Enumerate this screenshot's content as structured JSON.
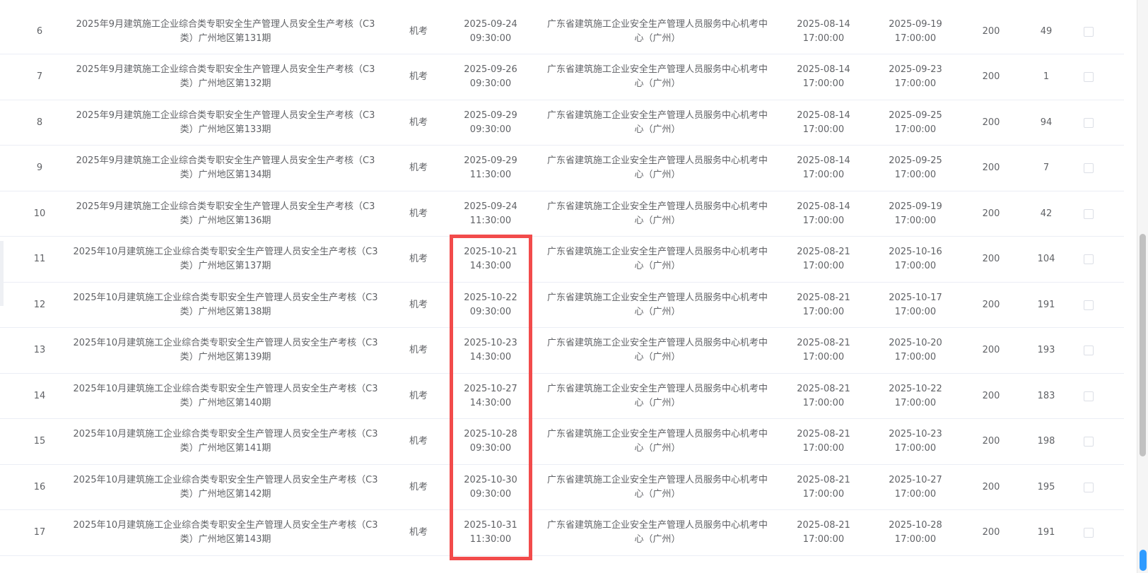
{
  "rows": [
    {
      "no": "6",
      "name": "2025年9月建筑施工企业综合类专职安全生产管理人员安全生产考核（C3类）广州地区第131期",
      "type": "机考",
      "exam_date": "2025-09-24",
      "exam_time": "09:30:00",
      "org": "广东省建筑施工企业安全生产管理人员服务中心机考中心（广州）",
      "open_date": "2025-08-14",
      "open_time": "17:00:00",
      "close_date": "2025-09-19",
      "close_time": "17:00:00",
      "capacity": "200",
      "remaining": "49"
    },
    {
      "no": "7",
      "name": "2025年9月建筑施工企业综合类专职安全生产管理人员安全生产考核（C3类）广州地区第132期",
      "type": "机考",
      "exam_date": "2025-09-26",
      "exam_time": "09:30:00",
      "org": "广东省建筑施工企业安全生产管理人员服务中心机考中心（广州）",
      "open_date": "2025-08-14",
      "open_time": "17:00:00",
      "close_date": "2025-09-23",
      "close_time": "17:00:00",
      "capacity": "200",
      "remaining": "1"
    },
    {
      "no": "8",
      "name": "2025年9月建筑施工企业综合类专职安全生产管理人员安全生产考核（C3类）广州地区第133期",
      "type": "机考",
      "exam_date": "2025-09-29",
      "exam_time": "09:30:00",
      "org": "广东省建筑施工企业安全生产管理人员服务中心机考中心（广州）",
      "open_date": "2025-08-14",
      "open_time": "17:00:00",
      "close_date": "2025-09-25",
      "close_time": "17:00:00",
      "capacity": "200",
      "remaining": "94"
    },
    {
      "no": "9",
      "name": "2025年9月建筑施工企业综合类专职安全生产管理人员安全生产考核（C3类）广州地区第134期",
      "type": "机考",
      "exam_date": "2025-09-29",
      "exam_time": "11:30:00",
      "org": "广东省建筑施工企业安全生产管理人员服务中心机考中心（广州）",
      "open_date": "2025-08-14",
      "open_time": "17:00:00",
      "close_date": "2025-09-25",
      "close_time": "17:00:00",
      "capacity": "200",
      "remaining": "7"
    },
    {
      "no": "10",
      "name": "2025年9月建筑施工企业综合类专职安全生产管理人员安全生产考核（C3类）广州地区第136期",
      "type": "机考",
      "exam_date": "2025-09-24",
      "exam_time": "11:30:00",
      "org": "广东省建筑施工企业安全生产管理人员服务中心机考中心（广州）",
      "open_date": "2025-08-14",
      "open_time": "17:00:00",
      "close_date": "2025-09-19",
      "close_time": "17:00:00",
      "capacity": "200",
      "remaining": "42"
    },
    {
      "no": "11",
      "name": "2025年10月建筑施工企业综合类专职安全生产管理人员安全生产考核（C3类）广州地区第137期",
      "type": "机考",
      "exam_date": "2025-10-21",
      "exam_time": "14:30:00",
      "org": "广东省建筑施工企业安全生产管理人员服务中心机考中心（广州）",
      "open_date": "2025-08-21",
      "open_time": "17:00:00",
      "close_date": "2025-10-16",
      "close_time": "17:00:00",
      "capacity": "200",
      "remaining": "104"
    },
    {
      "no": "12",
      "name": "2025年10月建筑施工企业综合类专职安全生产管理人员安全生产考核（C3类）广州地区第138期",
      "type": "机考",
      "exam_date": "2025-10-22",
      "exam_time": "09:30:00",
      "org": "广东省建筑施工企业安全生产管理人员服务中心机考中心（广州）",
      "open_date": "2025-08-21",
      "open_time": "17:00:00",
      "close_date": "2025-10-17",
      "close_time": "17:00:00",
      "capacity": "200",
      "remaining": "191"
    },
    {
      "no": "13",
      "name": "2025年10月建筑施工企业综合类专职安全生产管理人员安全生产考核（C3类）广州地区第139期",
      "type": "机考",
      "exam_date": "2025-10-23",
      "exam_time": "14:30:00",
      "org": "广东省建筑施工企业安全生产管理人员服务中心机考中心（广州）",
      "open_date": "2025-08-21",
      "open_time": "17:00:00",
      "close_date": "2025-10-20",
      "close_time": "17:00:00",
      "capacity": "200",
      "remaining": "193"
    },
    {
      "no": "14",
      "name": "2025年10月建筑施工企业综合类专职安全生产管理人员安全生产考核（C3类）广州地区第140期",
      "type": "机考",
      "exam_date": "2025-10-27",
      "exam_time": "14:30:00",
      "org": "广东省建筑施工企业安全生产管理人员服务中心机考中心（广州）",
      "open_date": "2025-08-21",
      "open_time": "17:00:00",
      "close_date": "2025-10-22",
      "close_time": "17:00:00",
      "capacity": "200",
      "remaining": "183"
    },
    {
      "no": "15",
      "name": "2025年10月建筑施工企业综合类专职安全生产管理人员安全生产考核（C3类）广州地区第141期",
      "type": "机考",
      "exam_date": "2025-10-28",
      "exam_time": "09:30:00",
      "org": "广东省建筑施工企业安全生产管理人员服务中心机考中心（广州）",
      "open_date": "2025-08-21",
      "open_time": "17:00:00",
      "close_date": "2025-10-23",
      "close_time": "17:00:00",
      "capacity": "200",
      "remaining": "198"
    },
    {
      "no": "16",
      "name": "2025年10月建筑施工企业综合类专职安全生产管理人员安全生产考核（C3类）广州地区第142期",
      "type": "机考",
      "exam_date": "2025-10-30",
      "exam_time": "09:30:00",
      "org": "广东省建筑施工企业安全生产管理人员服务中心机考中心（广州）",
      "open_date": "2025-08-21",
      "open_time": "17:00:00",
      "close_date": "2025-10-27",
      "close_time": "17:00:00",
      "capacity": "200",
      "remaining": "195"
    },
    {
      "no": "17",
      "name": "2025年10月建筑施工企业综合类专职安全生产管理人员安全生产考核（C3类）广州地区第143期",
      "type": "机考",
      "exam_date": "2025-10-31",
      "exam_time": "11:30:00",
      "org": "广东省建筑施工企业安全生产管理人员服务中心机考中心（广州）",
      "open_date": "2025-08-21",
      "open_time": "17:00:00",
      "close_date": "2025-10-28",
      "close_time": "17:00:00",
      "capacity": "200",
      "remaining": "191"
    }
  ],
  "colors": {
    "highlight": "#f24b4b",
    "text": "#606266",
    "border": "#ebeef5",
    "scroll_accent": "#2f9bff"
  }
}
